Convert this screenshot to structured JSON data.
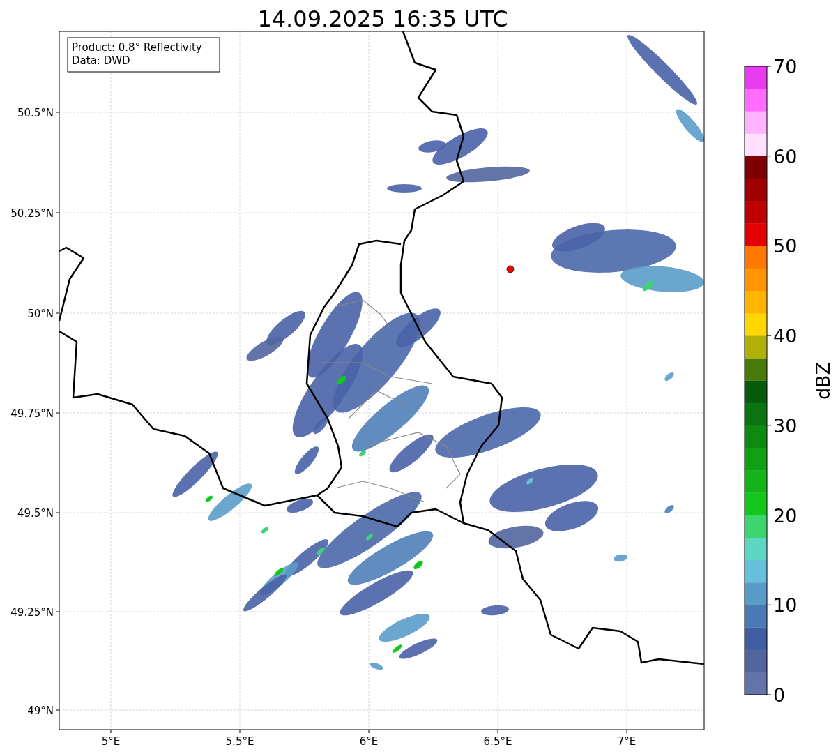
{
  "title": "14.09.2025 16:35 UTC",
  "info_box": {
    "lines": [
      "Product: 0.8° Reflectivity",
      "Data: DWD"
    ]
  },
  "map": {
    "lat_ticks": [
      "50.5°N",
      "50.25°N",
      "50°N",
      "49.75°N",
      "49.5°N",
      "49.25°N",
      "49°N"
    ],
    "lon_ticks": [
      "5°E",
      "5.5°E",
      "6°E",
      "6.5°E",
      "7°E"
    ]
  },
  "colorbar": {
    "label": "dBZ",
    "ticks": [
      "70",
      "60",
      "50",
      "40",
      "30",
      "20",
      "10",
      "0"
    ],
    "segments": [
      {
        "color": "#6473a8"
      },
      {
        "color": "#52669e"
      },
      {
        "color": "#405ea2"
      },
      {
        "color": "#4a7ab4"
      },
      {
        "color": "#5a9cc8"
      },
      {
        "color": "#66c0dc"
      },
      {
        "color": "#5ed6c4"
      },
      {
        "color": "#3cd670"
      },
      {
        "color": "#12c81a"
      },
      {
        "color": "#12b41a"
      },
      {
        "color": "#10a014"
      },
      {
        "color": "#0e8a12"
      },
      {
        "color": "#0a7410"
      },
      {
        "color": "#065c0c"
      },
      {
        "color": "#467a0a"
      },
      {
        "color": "#b0b008"
      },
      {
        "color": "#ffd700"
      },
      {
        "color": "#ffb400"
      },
      {
        "color": "#ff9600"
      },
      {
        "color": "#ff7800"
      },
      {
        "color": "#e20000"
      },
      {
        "color": "#c00000"
      },
      {
        "color": "#a00000"
      },
      {
        "color": "#7e0000"
      },
      {
        "color": "#ffe0ff"
      },
      {
        "color": "#ffb4ff"
      },
      {
        "color": "#ff6cff"
      },
      {
        "color": "#e83cee"
      }
    ]
  }
}
